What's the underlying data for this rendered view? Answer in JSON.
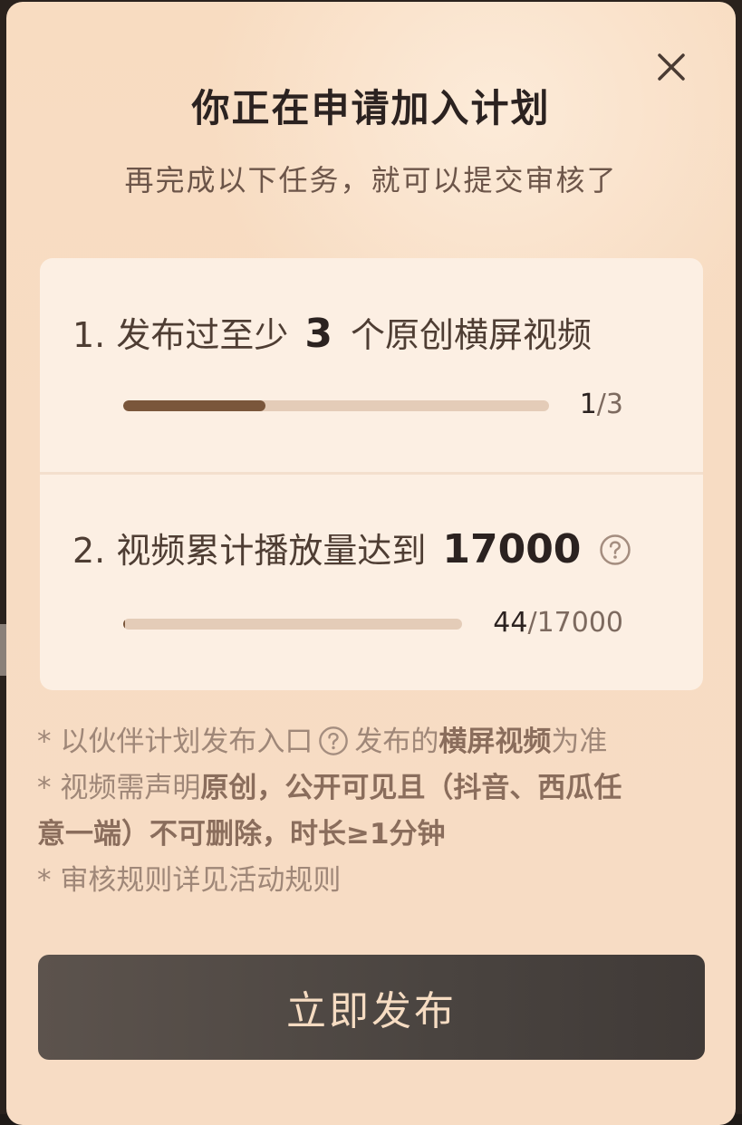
{
  "dialog": {
    "title": "你正在申请加入计划",
    "subtitle": "再完成以下任务，就可以提交审核了"
  },
  "tasks": [
    {
      "text_before": "1. 发布过至少",
      "highlight": "3",
      "text_after": "个原创横屏视频",
      "progress_current": "1",
      "progress_separator": "/",
      "progress_total": "3",
      "progress_fraction": 0.333,
      "has_help": false
    },
    {
      "text_before": "2. 视频累计播放量达到",
      "highlight": "17000",
      "text_after": "",
      "progress_current": "44",
      "progress_separator": "/",
      "progress_total": "17000",
      "progress_fraction": 0.0026,
      "has_help": true
    }
  ],
  "notes": {
    "line1_a": "* 以伙伴计划发布入口",
    "line1_b": "发布的",
    "line1_strong": "横屏视频",
    "line1_c": "为准",
    "line2_a": "* 视频需声明",
    "line2_strong1": "原创",
    "line2_strong2": "，公开可见且（抖音、西瓜任",
    "line3_strong": "意一端）不可删除，时长≥1分钟",
    "line4": "* 审核规则详见活动规则"
  },
  "publish_button": "立即发布",
  "icons": {
    "close": "close-icon",
    "help": "question-circle-icon"
  },
  "colors": {
    "progress_fill": "#7a563b",
    "progress_track": "#e4ccb8",
    "button_text": "#f6dcc2"
  }
}
